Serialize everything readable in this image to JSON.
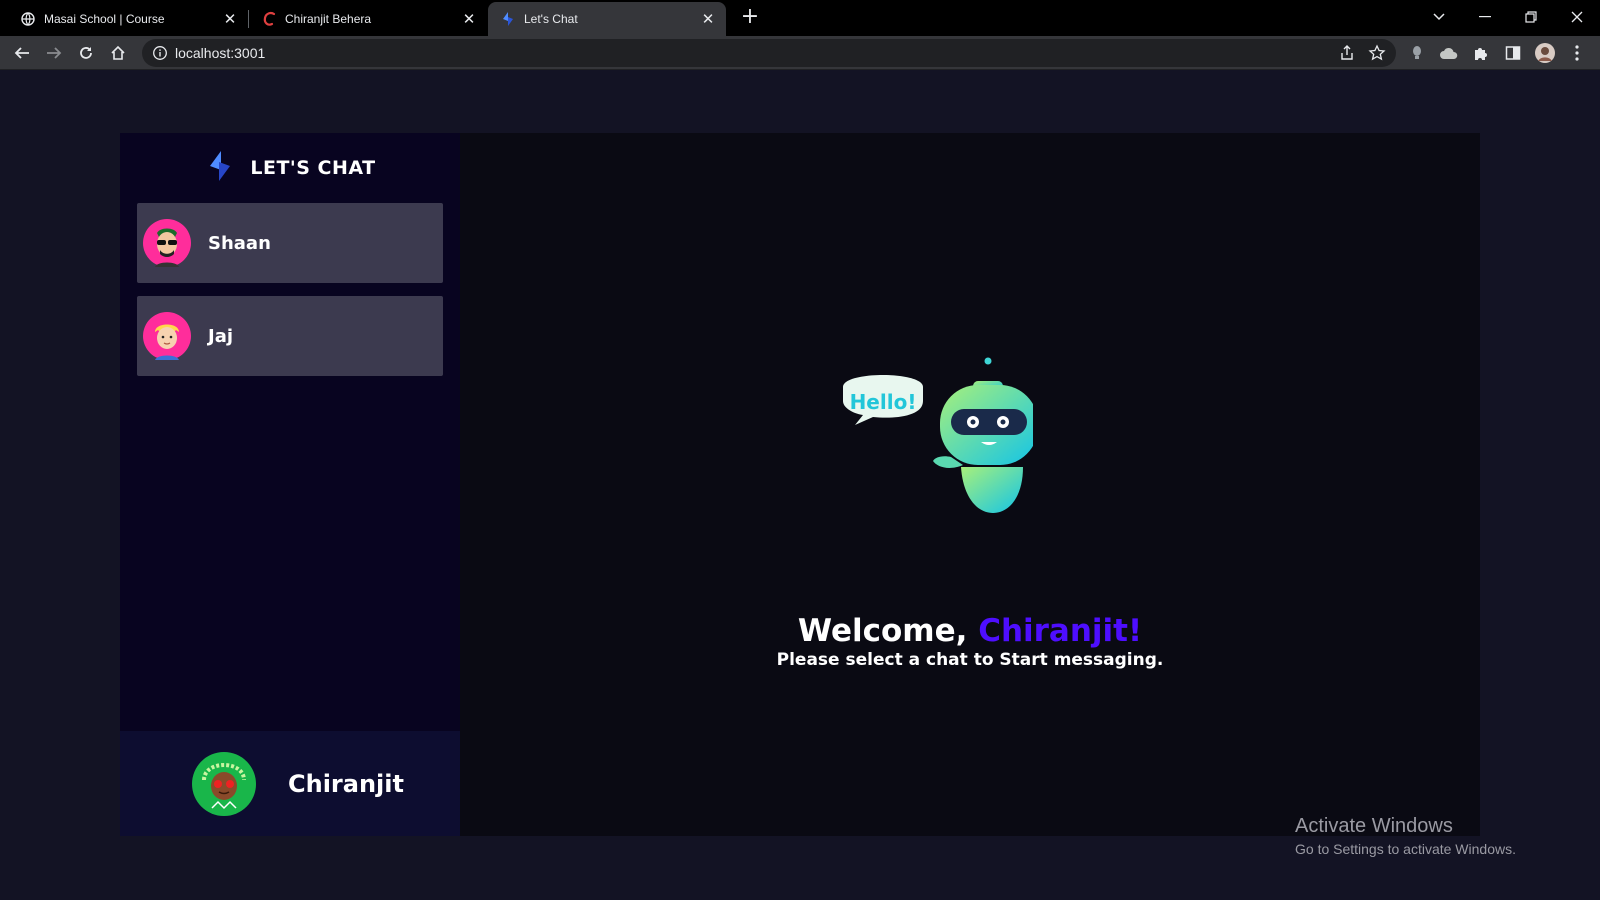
{
  "browser": {
    "tabs": [
      {
        "title": "Masai School | Course",
        "icon": "globe-icon"
      },
      {
        "title": "Chiranjit Behera",
        "icon": "c-logo-icon"
      },
      {
        "title": "Let's Chat",
        "icon": "app-logo-icon",
        "active": true
      }
    ],
    "url": "localhost:3001"
  },
  "app": {
    "brand": "LET'S CHAT",
    "contacts": [
      {
        "name": "Shaan",
        "avatar": "avatar-sunglasses-icon"
      },
      {
        "name": "Jaj",
        "avatar": "avatar-blonde-icon"
      }
    ],
    "current_user": {
      "name": "Chiranjit",
      "avatar": "avatar-green-icon"
    },
    "welcome": {
      "greeting": "Welcome, ",
      "username": "Chiranjit!",
      "subtitle": "Please select a chat to Start messaging.",
      "robot_bubble": "Hello!"
    },
    "colors": {
      "accent": "#4e0eff",
      "sidebar": "#080420",
      "contact_bg": "#3c3a4f",
      "main_bg": "#0a0a13"
    }
  },
  "watermark": {
    "line1": "Activate Windows",
    "line2": "Go to Settings to activate Windows."
  }
}
